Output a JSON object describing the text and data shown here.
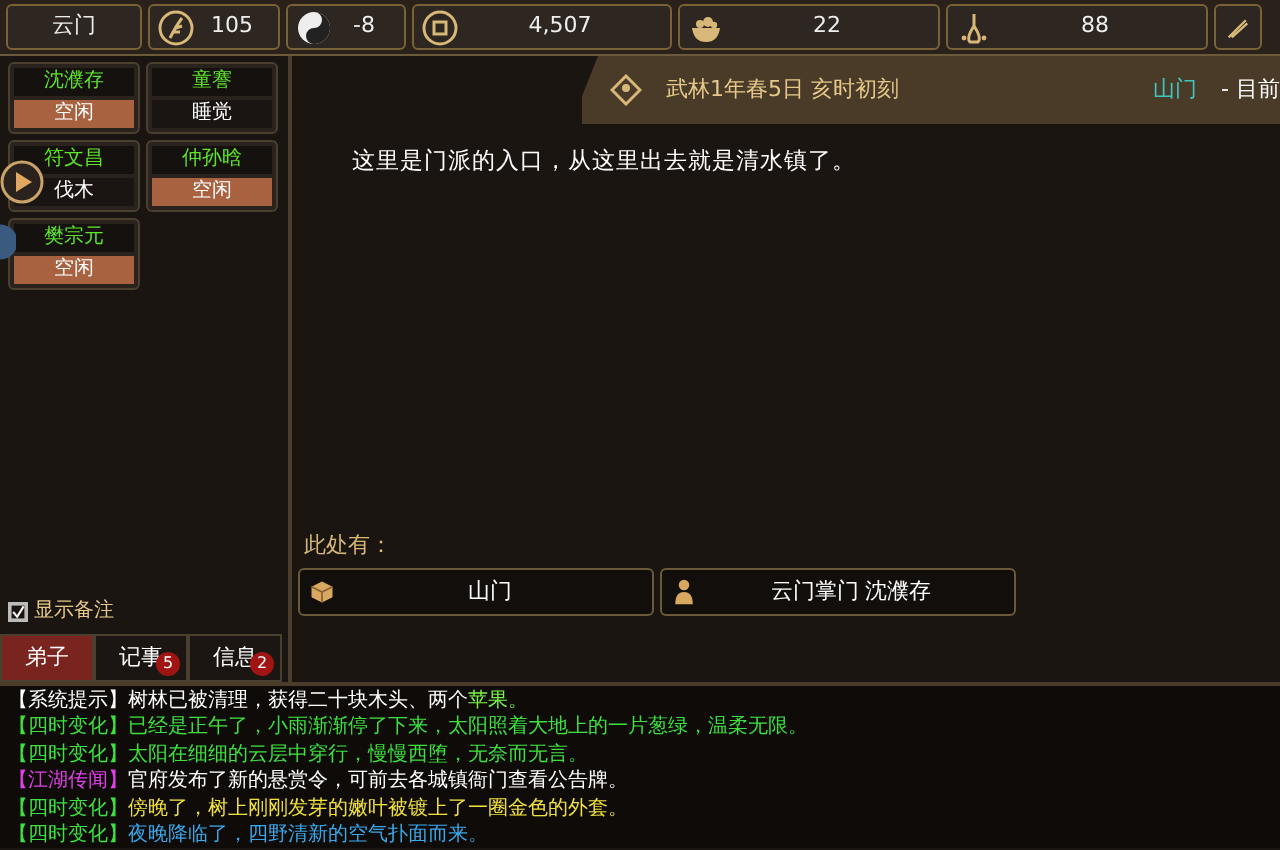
{
  "top_bar": {
    "location": "云门",
    "resources": [
      {
        "kind": "grain",
        "value": "105"
      },
      {
        "kind": "taiji",
        "value": "-8"
      },
      {
        "kind": "coin",
        "value": "4,507"
      },
      {
        "kind": "rice",
        "value": "22"
      },
      {
        "kind": "gourd",
        "value": "88"
      },
      {
        "kind": "scroll"
      }
    ]
  },
  "disciples": [
    {
      "name": "沈濮存",
      "status": "空闲",
      "idle": true
    },
    {
      "name": "童謇",
      "status": "睡觉",
      "idle": false
    },
    {
      "name": "符文昌",
      "status": "伐木",
      "idle": false
    },
    {
      "name": "仲孙晗",
      "status": "空闲",
      "idle": true
    },
    {
      "name": "樊宗元",
      "status": "空闲",
      "idle": true
    }
  ],
  "show_notes": {
    "label": "显示备注",
    "checked": true
  },
  "tabs": [
    {
      "label": "弟子",
      "selected": true
    },
    {
      "label": "记事",
      "selected": false,
      "badge": "5"
    },
    {
      "label": "信息",
      "selected": false,
      "badge": "2"
    }
  ],
  "scene": {
    "date": "武林1年春5日 亥时初刻",
    "location": "山门",
    "location_suffix": "- 目前",
    "description": "这里是门派的入口，从这里出去就是清水镇了。",
    "here_label": "此处有：",
    "objects": [
      {
        "kind": "place",
        "label": "山门"
      },
      {
        "kind": "person",
        "label": "云门掌门 沈濮存"
      }
    ]
  },
  "log": [
    {
      "parts": [
        {
          "text": "【系统提示】",
          "color": "#ffffff"
        },
        {
          "text": "树林已被清理，获得二十块木头、两个",
          "color": "#ffffff"
        },
        {
          "text": "苹果。",
          "color": "#7cf24a"
        }
      ]
    },
    {
      "parts": [
        {
          "text": "【四时变化】",
          "color": "#3ee03e"
        },
        {
          "text": "已经是正午了，小雨渐渐停了下来，太阳照着大地上的一片葱绿，温柔无限。",
          "color": "#3ee03e"
        }
      ]
    },
    {
      "parts": [
        {
          "text": "【四时变化】",
          "color": "#3ee03e"
        },
        {
          "text": "太阳在细细的云层中穿行，慢慢西堕，无奈而无言。",
          "color": "#3ee03e"
        }
      ]
    },
    {
      "parts": [
        {
          "text": "【江湖传闻】",
          "color": "#e040e8"
        },
        {
          "text": "官府发布了新的悬赏令，可前去各城镇衙门查看公告牌。",
          "color": "#ffffff"
        }
      ]
    },
    {
      "parts": [
        {
          "text": "【四时变化】",
          "color": "#3ee03e"
        },
        {
          "text": "傍晚了，树上刚刚发芽的嫩叶被镀上了一圈金色的外套。",
          "color": "#f0e040"
        }
      ]
    },
    {
      "parts": [
        {
          "text": "【四时变化】",
          "color": "#3ee03e"
        },
        {
          "text": "夜晚降临了，四野清新的空气扑面而来。",
          "color": "#3aa8ea"
        }
      ]
    }
  ]
}
